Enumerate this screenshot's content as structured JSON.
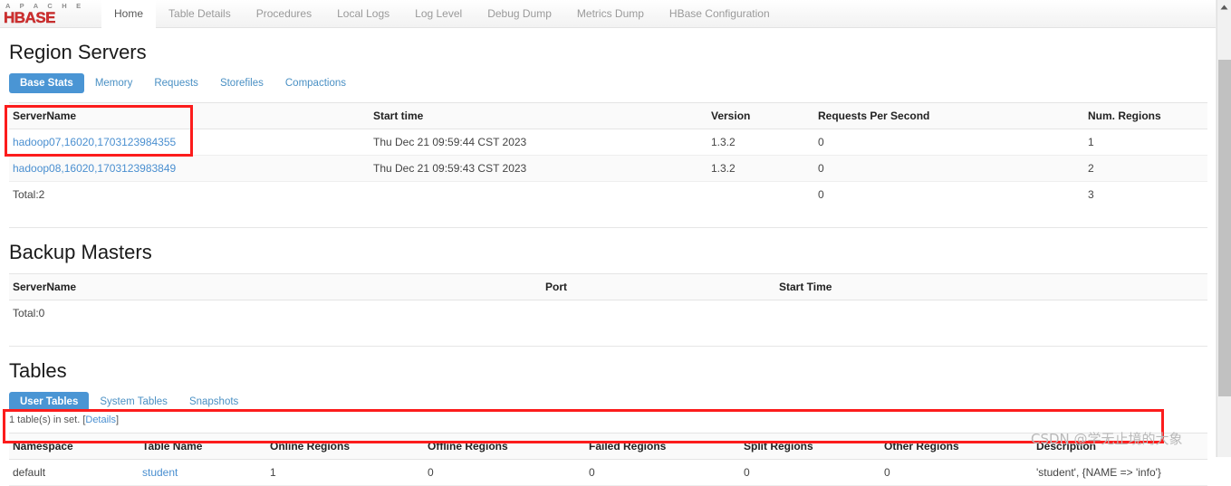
{
  "brand": {
    "apache": "A P A C H E",
    "hbase": "HBASE"
  },
  "nav": {
    "items": [
      {
        "label": "Home",
        "active": true
      },
      {
        "label": "Table Details",
        "active": false
      },
      {
        "label": "Procedures",
        "active": false
      },
      {
        "label": "Local Logs",
        "active": false
      },
      {
        "label": "Log Level",
        "active": false
      },
      {
        "label": "Debug Dump",
        "active": false
      },
      {
        "label": "Metrics Dump",
        "active": false
      },
      {
        "label": "HBase Configuration",
        "active": false
      }
    ]
  },
  "region_servers": {
    "title": "Region Servers",
    "tabs": [
      {
        "label": "Base Stats",
        "active": true
      },
      {
        "label": "Memory",
        "active": false
      },
      {
        "label": "Requests",
        "active": false
      },
      {
        "label": "Storefiles",
        "active": false
      },
      {
        "label": "Compactions",
        "active": false
      }
    ],
    "columns": [
      "ServerName",
      "Start time",
      "Version",
      "Requests Per Second",
      "Num. Regions"
    ],
    "rows": [
      {
        "server_name": "hadoop07,16020,1703123984355",
        "start_time": "Thu Dec 21 09:59:44 CST 2023",
        "version": "1.3.2",
        "requests_per_second": "0",
        "num_regions": "1"
      },
      {
        "server_name": "hadoop08,16020,1703123983849",
        "start_time": "Thu Dec 21 09:59:43 CST 2023",
        "version": "1.3.2",
        "requests_per_second": "0",
        "num_regions": "2"
      }
    ],
    "total": {
      "label": "Total:2",
      "start_time": "",
      "version": "",
      "requests_per_second": "0",
      "num_regions": "3"
    }
  },
  "backup_masters": {
    "title": "Backup Masters",
    "columns": [
      "ServerName",
      "Port",
      "Start Time"
    ],
    "rows": [],
    "total": {
      "label": "Total:0"
    }
  },
  "tables": {
    "title": "Tables",
    "tabs": [
      {
        "label": "User Tables",
        "active": true
      },
      {
        "label": "System Tables",
        "active": false
      },
      {
        "label": "Snapshots",
        "active": false
      }
    ],
    "meta_text": "1 table(s) in set. [",
    "meta_link": "Details",
    "meta_text_end": "]",
    "columns": [
      "Namespace",
      "Table Name",
      "Online Regions",
      "Offline Regions",
      "Failed Regions",
      "Split Regions",
      "Other Regions",
      "Description"
    ],
    "rows": [
      {
        "namespace": "default",
        "table_name": "student",
        "online_regions": "1",
        "offline_regions": "0",
        "failed_regions": "0",
        "split_regions": "0",
        "other_regions": "0",
        "description": "'student', {NAME => 'info'}"
      }
    ]
  },
  "watermark": "CSDN @学无止境的大象",
  "colors": {
    "brand_red": "#cf2f2f",
    "accent_blue": "#4a95d4",
    "link_blue": "#4a8fd0",
    "annotation_red": "#fc1c1c"
  }
}
